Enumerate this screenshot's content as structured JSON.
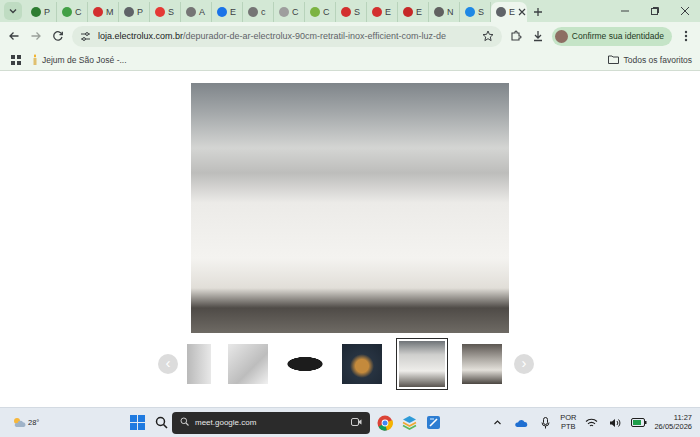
{
  "browser": {
    "tabs": [
      {
        "label": "P",
        "selected": false,
        "color": "#2e7d32"
      },
      {
        "label": "C",
        "selected": false,
        "color": "#43a047"
      },
      {
        "label": "M",
        "selected": false,
        "color": "#d32f2f"
      },
      {
        "label": "P",
        "selected": false,
        "color": "#5f6368"
      },
      {
        "label": "S",
        "selected": false,
        "color": "#e53935"
      },
      {
        "label": "A",
        "selected": false,
        "color": "#757575"
      },
      {
        "label": "E",
        "selected": false,
        "color": "#1a73e8"
      },
      {
        "label": "c",
        "selected": false,
        "color": "#757575"
      },
      {
        "label": "C",
        "selected": false,
        "color": "#9e9e9e"
      },
      {
        "label": "C",
        "selected": false,
        "color": "#7cb342"
      },
      {
        "label": "S",
        "selected": false,
        "color": "#d32f2f"
      },
      {
        "label": "E",
        "selected": false,
        "color": "#d32f2f"
      },
      {
        "label": "E",
        "selected": false,
        "color": "#c62828"
      },
      {
        "label": "N",
        "selected": false,
        "color": "#616161"
      },
      {
        "label": "S",
        "selected": false,
        "color": "#1e88e5"
      },
      {
        "label": "E",
        "selected": true,
        "color": "#5f6368"
      }
    ],
    "address": {
      "host": "loja.electrolux.com.br",
      "path": "/depurador-de-ar-electrolux-90cm-retratil-inox-efficient-com-luz-de"
    },
    "profile": "Confirme sua identidade",
    "bookmarks": [
      {
        "label": "Jejum de São José -..."
      }
    ],
    "all_bookmarks": "Todos os favoritos"
  },
  "page": {
    "gallery": {
      "prev": "‹",
      "next": "›",
      "thumbnails": [
        {
          "selected": false
        },
        {
          "selected": false
        },
        {
          "selected": false
        },
        {
          "selected": false
        },
        {
          "selected": true
        },
        {
          "selected": false
        }
      ]
    }
  },
  "taskbar": {
    "weather": "28°",
    "search": "meet.google.com",
    "language": [
      "POR",
      "PTB"
    ],
    "time": "11:27",
    "date": "26/05/2026"
  }
}
